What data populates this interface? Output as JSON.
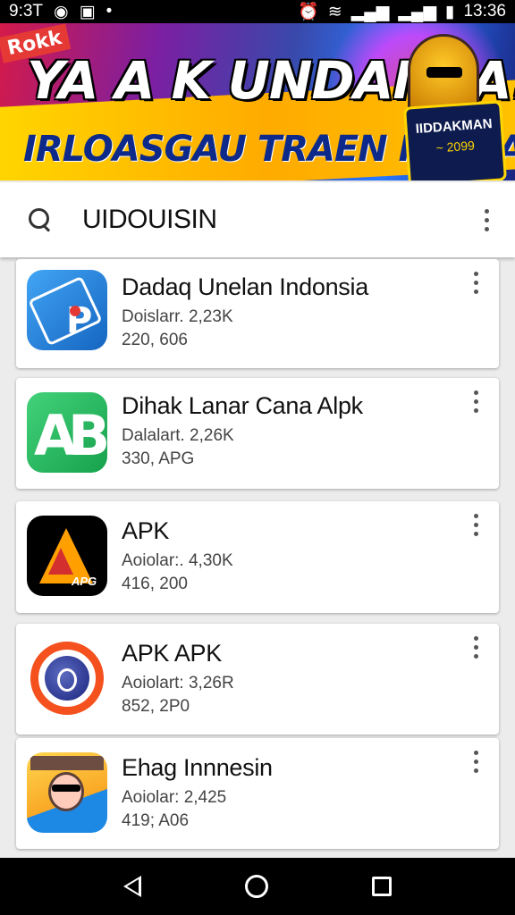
{
  "status_bar": {
    "time_left": "9:3T",
    "time_right": "13:36",
    "icons_left": [
      "messenger-icon",
      "gallery-icon",
      "dots-icon"
    ],
    "icons_right": [
      "alarm-icon",
      "wifi-icon",
      "signal-icon",
      "signal-icon",
      "battery-icon"
    ]
  },
  "banner": {
    "corner_tag": "Rokk",
    "headline": "YA A K UNDANSA!",
    "subline": "IRLOASGAU TRAEN INDOADN!",
    "badge_line1": "IIDDAKMAN",
    "badge_line2": "~ 2099",
    "colors": {
      "headline": "#ffffff",
      "subline": "#0d2a8a",
      "ribbon": "#ffd600"
    }
  },
  "search": {
    "query": "UIDOUISIN",
    "icon": "search-icon",
    "menu_icon": "more-vert-icon"
  },
  "apps": [
    {
      "name": "Dadaq Unelan Indonsia",
      "meta1": "Doislarr. 2,23K",
      "meta2": "220, 606",
      "icon": "blue-apk-icon"
    },
    {
      "name": "Dihak Lanar Cana Alpk",
      "meta1": "Dalalart. 2,26K",
      "meta2": "330, APG",
      "icon": "green-ab-icon"
    },
    {
      "name": "APK",
      "meta1": "Aoiolar:. 4,30K",
      "meta2": "416, 200",
      "icon": "black-a-icon"
    },
    {
      "name": "APK APK",
      "meta1": "Aoiolart: 3,26R",
      "meta2": "852, 2P0",
      "icon": "red-ring-icon"
    },
    {
      "name": "Ehag Innnesin",
      "meta1": "Aoiolar: 2,425",
      "meta2": "419; A06",
      "icon": "yellow-character-icon"
    }
  ],
  "nav": {
    "back": "back-icon",
    "home": "home-icon",
    "recents": "recents-icon"
  }
}
